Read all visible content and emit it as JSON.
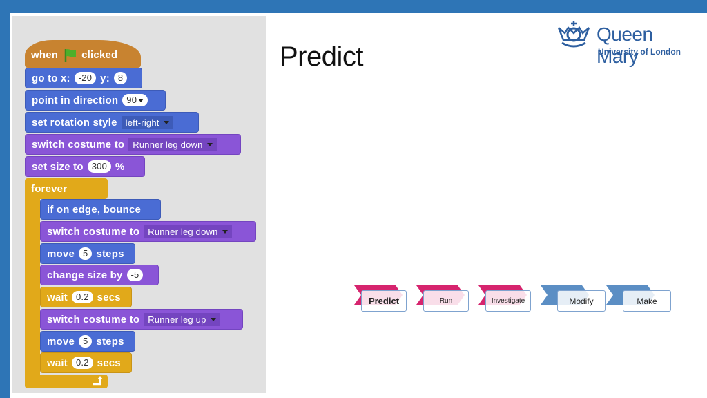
{
  "slide": {
    "title": "Predict",
    "logo": {
      "name": "Queen Mary",
      "subtitle": "University of London"
    }
  },
  "scratch": {
    "hat": {
      "pre": "when",
      "post": "clicked"
    },
    "blocks": [
      {
        "parts": [
          "go to x:",
          "-20",
          "y:",
          "8"
        ]
      },
      {
        "label": "point in direction",
        "value": "90"
      },
      {
        "label": "set rotation style",
        "dropdown": "left-right"
      },
      {
        "label": "switch costume to",
        "dropdown": "Runner leg down"
      },
      {
        "label": "set size to",
        "value": "300",
        "suffix": "%"
      }
    ],
    "forever": {
      "label": "forever",
      "blocks": [
        {
          "label": "if on edge, bounce"
        },
        {
          "label": "switch costume to",
          "dropdown": "Runner leg down"
        },
        {
          "label": "move",
          "value": "5",
          "suffix": "steps"
        },
        {
          "label": "change size by",
          "value": "-5"
        },
        {
          "label": "wait",
          "value": "0.2",
          "suffix": "secs"
        },
        {
          "label": "switch costume to",
          "dropdown": "Runner leg up"
        },
        {
          "label": "move",
          "value": "5",
          "suffix": "steps"
        },
        {
          "label": "wait",
          "value": "0.2",
          "suffix": "secs"
        }
      ]
    }
  },
  "process": {
    "steps": [
      {
        "label": "Predict",
        "color": "#d6246e",
        "active": true
      },
      {
        "label": "Run",
        "color": "#d6246e"
      },
      {
        "label": "Investigate",
        "color": "#d6246e"
      },
      {
        "label": "Modify",
        "color": "#5b8ec4"
      },
      {
        "label": "Make",
        "color": "#5b8ec4"
      }
    ]
  }
}
